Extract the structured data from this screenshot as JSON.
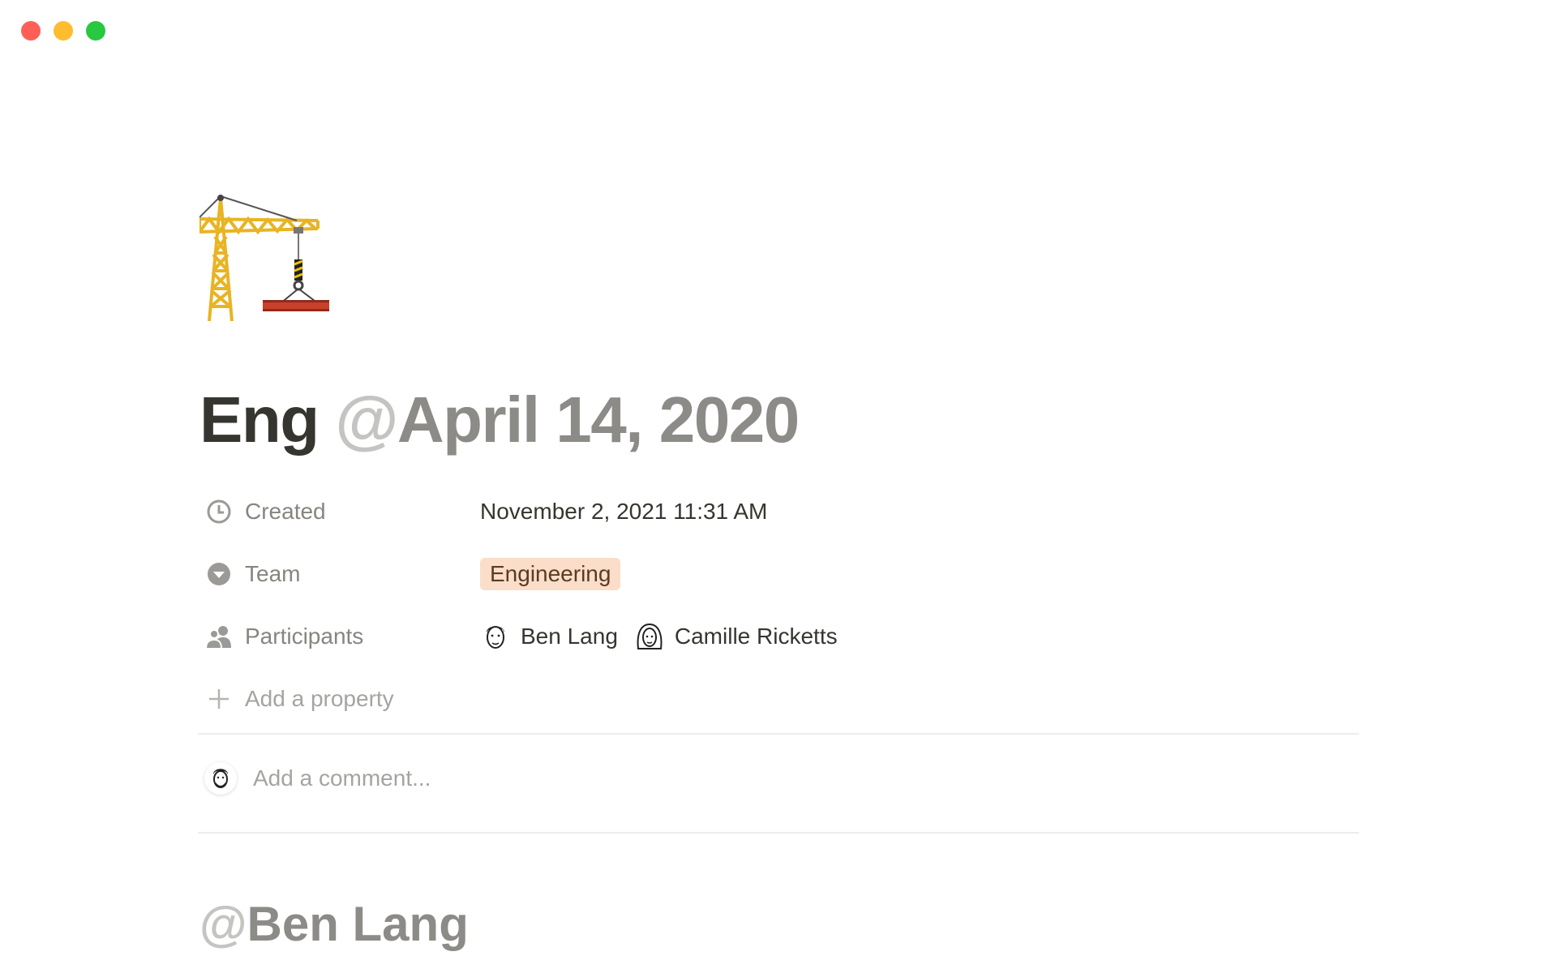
{
  "window": {
    "controls": [
      {
        "name": "close",
        "color": "#ff5f57"
      },
      {
        "name": "minimize",
        "color": "#febc2e"
      },
      {
        "name": "zoom",
        "color": "#28c840"
      }
    ]
  },
  "page": {
    "icon": "building-construction-crane-icon",
    "title": "Eng",
    "title_mention_prefix": "@",
    "title_mention": "April 14, 2020"
  },
  "properties": [
    {
      "icon": "clock-icon",
      "name": "Created",
      "value": "November 2, 2021 11:31 AM"
    },
    {
      "icon": "select-circle-icon",
      "name": "Team",
      "tag": "Engineering",
      "tag_color": "#fadec9"
    },
    {
      "icon": "people-icon",
      "name": "Participants",
      "people": [
        "Ben Lang",
        "Camille Ricketts"
      ]
    }
  ],
  "add_property": {
    "icon": "plus-icon",
    "label": "Add a property"
  },
  "comment": {
    "placeholder": "Add a comment..."
  },
  "heading": {
    "mention_prefix": "@",
    "mention": "Ben Lang"
  }
}
